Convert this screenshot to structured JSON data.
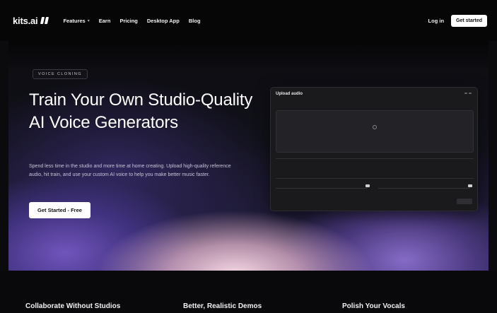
{
  "nav": {
    "logo_text": "kits.ai",
    "links": [
      {
        "label": "Features",
        "has_dropdown": true
      },
      {
        "label": "Earn"
      },
      {
        "label": "Pricing"
      },
      {
        "label": "Desktop App"
      },
      {
        "label": "Blog"
      }
    ],
    "login_label": "Log in",
    "cta_label": "Get started"
  },
  "hero": {
    "eyebrow": "VOICE CLONING",
    "title": "Train Your Own Studio-Quality AI Voice Generators",
    "subtitle": "Spend less time in the studio and more time at home creating. Upload high-quality reference audio, hit train, and use your custom AI voice to help you make better music faster.",
    "cta_label": "Get Started - Free"
  },
  "upload_panel": {
    "title": "Upload audio"
  },
  "features": [
    {
      "title": "Collaborate Without Studios"
    },
    {
      "title": "Better, Realistic Demos"
    },
    {
      "title": "Polish Your Vocals"
    }
  ],
  "colors": {
    "nav_bg": "#060607",
    "page_bg": "#0b0b0d",
    "glow_pink": "#f0bed2",
    "glow_purple": "#6e50b4",
    "button_bg": "#ffffff"
  }
}
